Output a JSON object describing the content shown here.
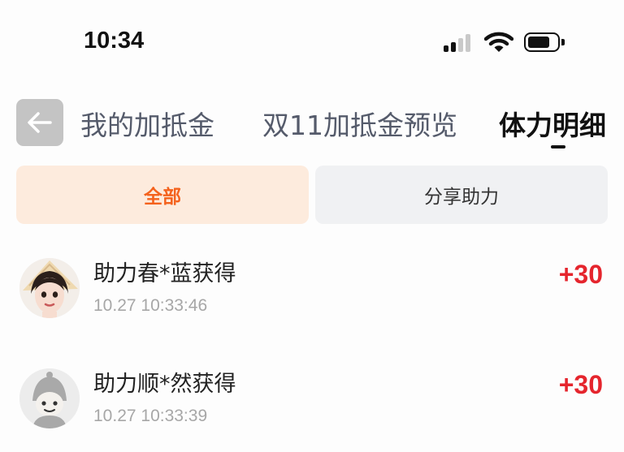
{
  "status_bar": {
    "time": "10:34"
  },
  "nav": {
    "tabs": [
      {
        "label": "我的加抵金"
      },
      {
        "label": "双11加抵金预览"
      },
      {
        "label": "体力明细"
      }
    ]
  },
  "filters": [
    {
      "label": "全部"
    },
    {
      "label": "分享助力"
    }
  ],
  "records": [
    {
      "title": "助力春*蓝获得",
      "time": "10.27 10:33:46",
      "amount": "+30"
    },
    {
      "title": "助力顺*然获得",
      "time": "10.27 10:33:39",
      "amount": "+30"
    }
  ],
  "colors": {
    "accent": "#f4621d",
    "amount_red": "#e5252d",
    "active_chip_bg": "#fdebdd",
    "chip_bg": "#f0f1f3"
  }
}
